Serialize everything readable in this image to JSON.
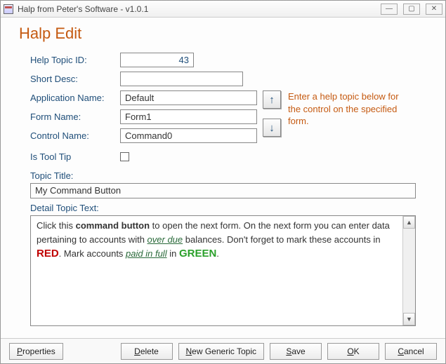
{
  "window": {
    "title": "Halp from Peter's Software - v1.0.1"
  },
  "page": {
    "title": "Halp Edit"
  },
  "form": {
    "help_topic_id_label": "Help Topic ID:",
    "help_topic_id": "43",
    "short_desc_label": "Short Desc:",
    "short_desc": "",
    "application_name_label": "Application Name:",
    "application_name": "Default",
    "form_name_label": "Form Name:",
    "form_name": "Form1",
    "control_name_label": "Control Name:",
    "control_name": "Command0",
    "is_tooltip_label": "Is Tool Tip",
    "is_tooltip_checked": false,
    "hint": "Enter a help topic below for the control on the specified form.",
    "topic_title_label": "Topic Title:",
    "topic_title": "My Command Button",
    "detail_label": "Detail Topic Text:",
    "detail": {
      "pre1": "Click this ",
      "cmd": "command button",
      "mid1": " to open the next form. On the next form you can enter data pertaining to accounts with ",
      "overdue": "over due",
      "mid2": " balances. Don't forget to mark these accounts in ",
      "red": "RED",
      "mid3": ". Mark accounts ",
      "paid": "paid in full",
      "mid4": " in ",
      "green": "GREEN",
      "end": "."
    }
  },
  "buttons": {
    "properties": "Properties",
    "delete": "Delete",
    "new_generic": "New Generic Topic",
    "save": "Save",
    "ok": "OK",
    "cancel": "Cancel"
  },
  "controls": {
    "min": "—",
    "max": "▢",
    "close": "✕",
    "up": "↑",
    "down": "↓",
    "sb_up": "▲",
    "sb_down": "▼"
  }
}
